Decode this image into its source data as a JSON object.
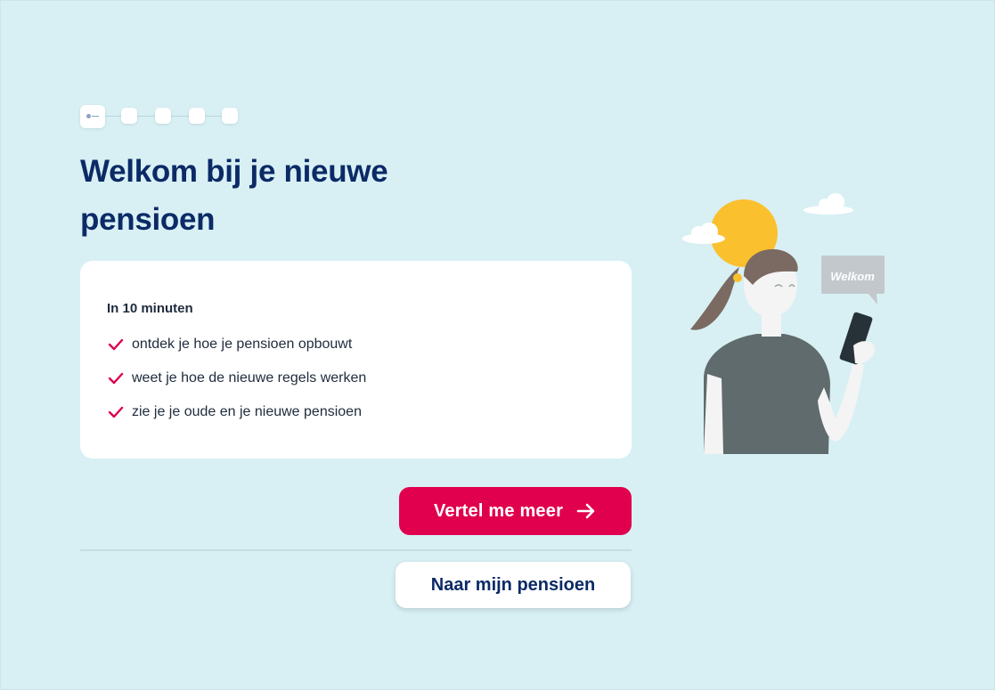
{
  "stepper": {
    "total_steps": 5,
    "current_step": 1
  },
  "title": "Welkom bij je nieuwe pensioen",
  "intro_card": {
    "heading": "In 10 minuten",
    "items": [
      "ontdek je hoe je pensioen opbouwt",
      "weet je hoe de nieuwe regels werken",
      "zie je je oude en je nieuwe pensioen"
    ]
  },
  "actions": {
    "primary_label": "Vertel me meer",
    "secondary_label": "Naar mijn pensioen"
  },
  "illustration": {
    "speech_bubble_text": "Welkom"
  },
  "colors": {
    "background": "#d8f0f4",
    "title": "#0b2a66",
    "accent": "#e0004d",
    "check": "#e0004d",
    "sun": "#fbc02d"
  }
}
